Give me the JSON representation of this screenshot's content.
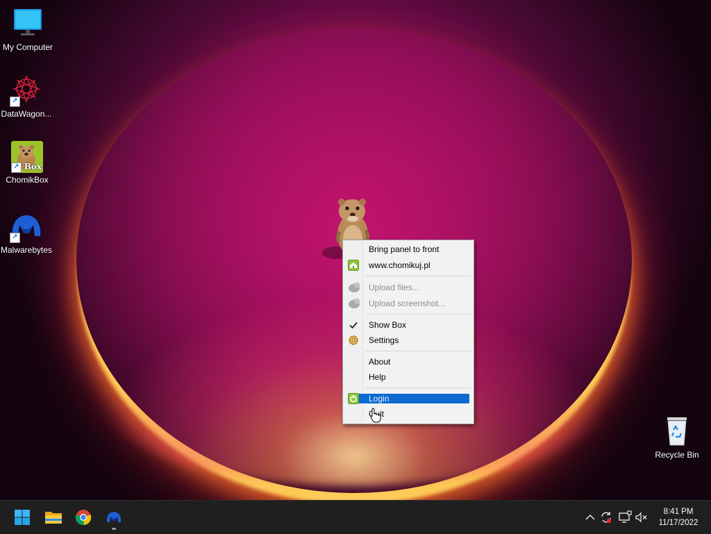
{
  "desktop": {
    "icons": [
      {
        "label": "My Computer",
        "icon": "monitor-icon"
      },
      {
        "label": "DataWagon...",
        "icon": "datawagon-icon"
      },
      {
        "label": "ChomikBox",
        "icon": "chomikbox-icon",
        "badge": "Box"
      },
      {
        "label": "Malwarebytes",
        "icon": "malwarebytes-icon"
      }
    ],
    "recycle_bin": {
      "label": "Recycle Bin",
      "icon": "recycle-bin-icon"
    }
  },
  "context_menu": {
    "items": [
      {
        "label": "Bring panel to front",
        "enabled": true
      },
      {
        "label": "www.chomikuj.pl",
        "enabled": true,
        "icon": "home-icon"
      },
      {
        "label": "Upload files...",
        "enabled": false,
        "icon": "upload-hamster-icon"
      },
      {
        "label": "Upload screenshot...",
        "enabled": false,
        "icon": "upload-hamster-icon"
      },
      {
        "label": "Show Box",
        "enabled": true,
        "checked": true
      },
      {
        "label": "Settings",
        "enabled": true,
        "icon": "gear-icon"
      },
      {
        "label": "About",
        "enabled": true
      },
      {
        "label": "Help",
        "enabled": true
      },
      {
        "label": "Login",
        "enabled": true,
        "icon": "power-icon",
        "highlighted": true
      },
      {
        "label": "Quit",
        "enabled": true
      }
    ]
  },
  "taskbar": {
    "pinned": [
      {
        "name": "start",
        "icon": "windows-start-icon"
      },
      {
        "name": "file-explorer",
        "icon": "folder-icon"
      },
      {
        "name": "chrome",
        "icon": "chrome-icon"
      },
      {
        "name": "malwarebytes",
        "icon": "malwarebytes-icon",
        "running": true
      }
    ],
    "tray": {
      "icons": [
        "chevron-up-icon",
        "sync-icon",
        "network-icon",
        "volume-muted-icon"
      ]
    },
    "clock": {
      "time": "8:41 PM",
      "date": "11/17/2022"
    }
  },
  "colors": {
    "menu_highlight": "#0c6ad1",
    "taskbar_bg": "#1f1f1f",
    "wallpaper_magenta": "#b0126e"
  }
}
